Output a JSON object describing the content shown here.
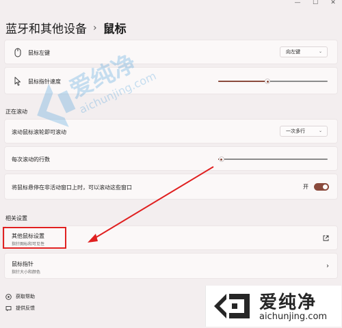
{
  "window": {
    "controls": [
      "—",
      "☐",
      "✕"
    ]
  },
  "breadcrumb": {
    "parent": "蓝牙和其他设备",
    "separator": "›",
    "current": "鼠标"
  },
  "settings": {
    "primary_button": {
      "label": "鼠标左键",
      "value": "向左键"
    },
    "pointer_speed": {
      "label": "鼠标指针速度",
      "level": 0.45
    },
    "scrolling_section": "正在滚动",
    "scroll_mode": {
      "label": "滚动鼠标滚轮即可滚动",
      "value": "一次多行"
    },
    "scroll_lines": {
      "label": "每次滚动的行数",
      "level": 0.03
    },
    "inactive_scroll": {
      "label": "将鼠标悬停在非活动窗口上时，可以滚动这些窗口",
      "state": "开"
    },
    "related_section": "相关设置",
    "additional_mouse": {
      "label": "其他鼠标设置",
      "desc": "指针图标和可见性"
    },
    "mouse_pointer": {
      "label": "鼠标指针",
      "desc": "指针大小和颜色"
    }
  },
  "help": {
    "get_help": "获取帮助",
    "feedback": "提供反馈"
  },
  "watermark": {
    "brand": "爱纯净",
    "url": "aichunjing.com"
  },
  "colors": {
    "accent": "#8a4a3c",
    "annotation": "#e02020"
  }
}
